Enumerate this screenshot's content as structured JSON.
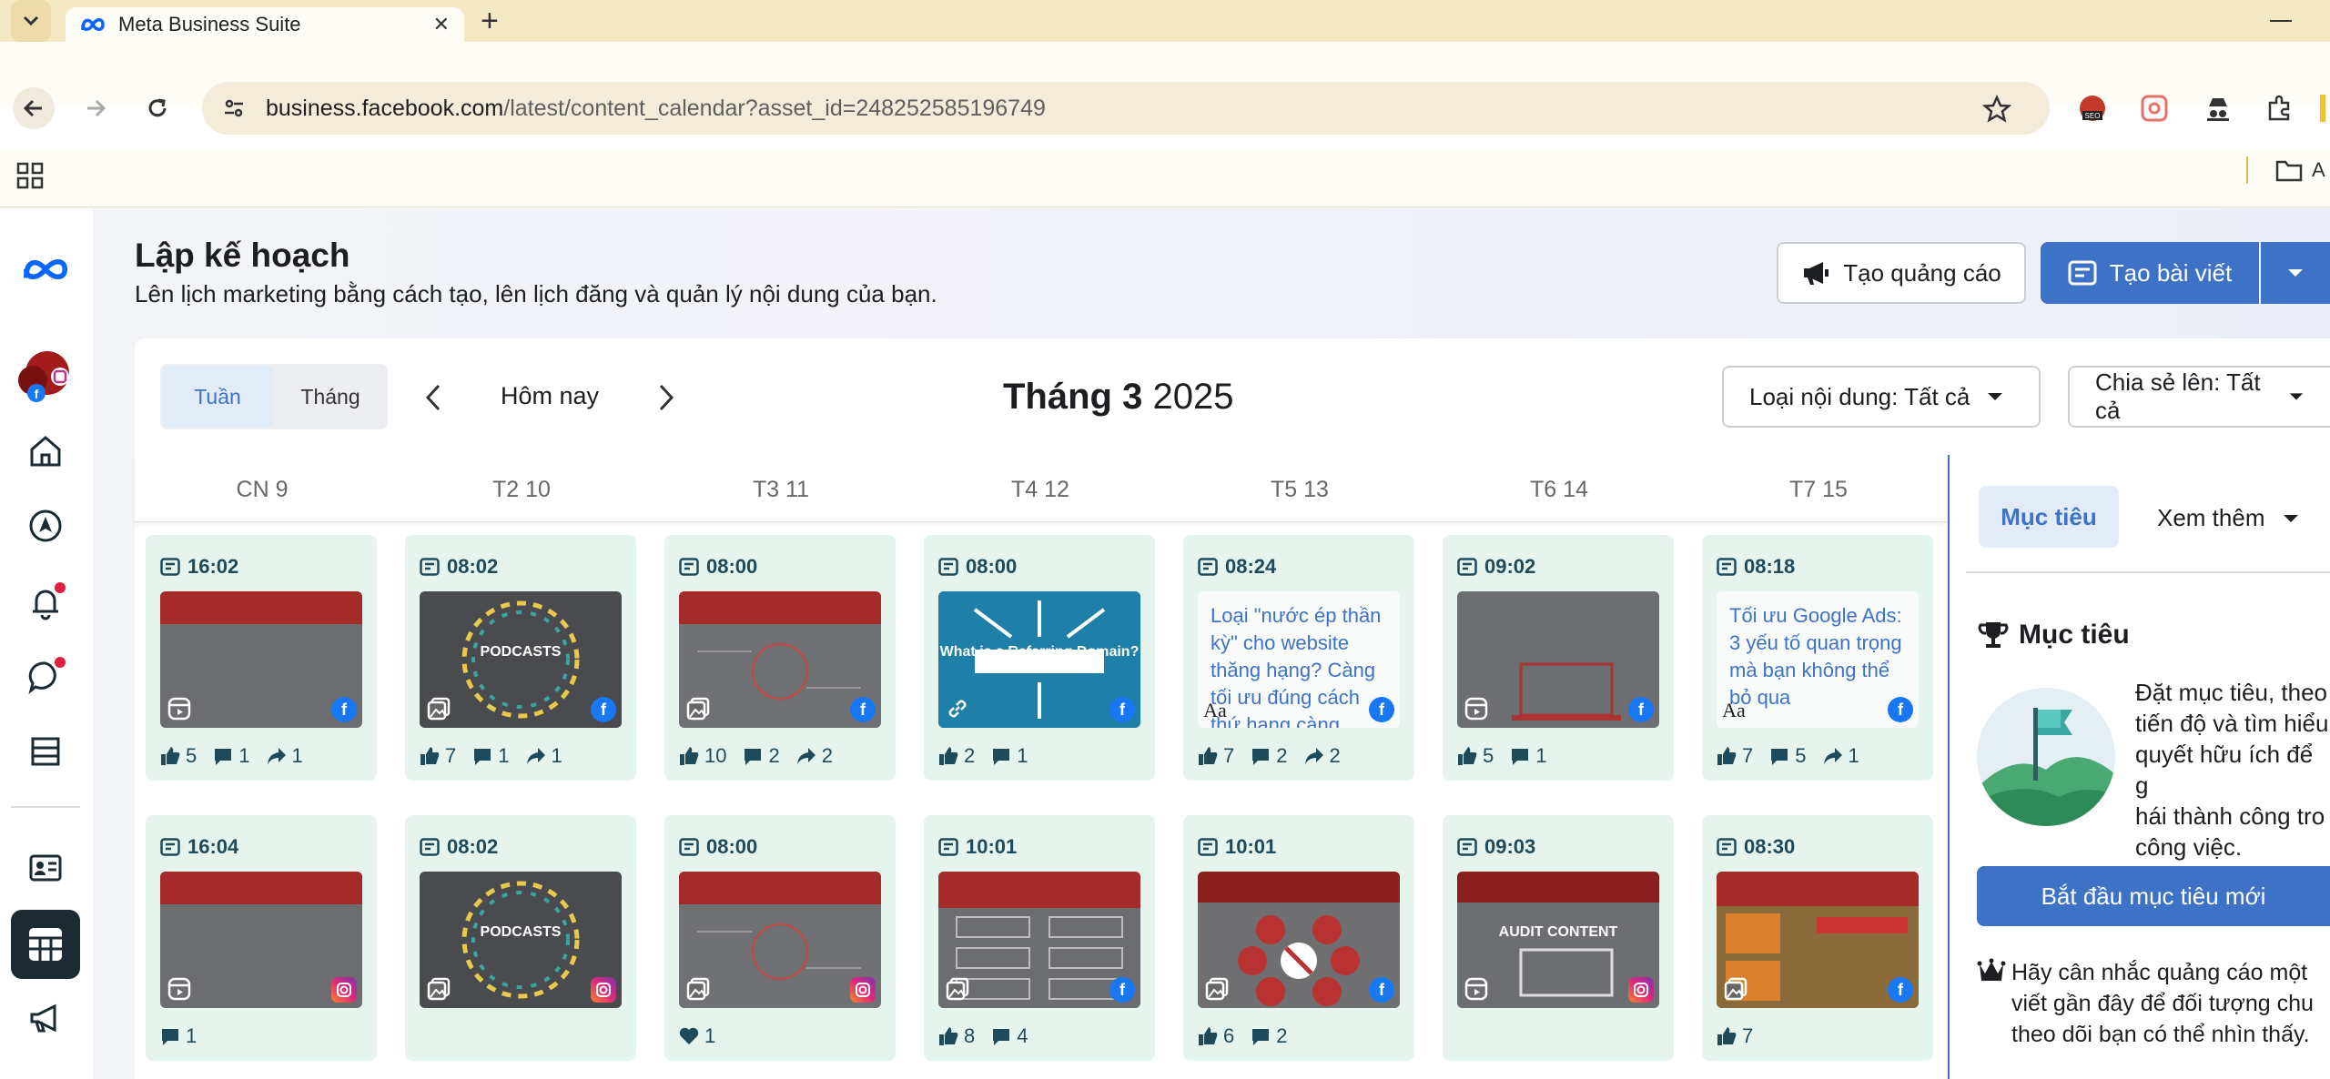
{
  "browser": {
    "tab_title": "Meta Business Suite",
    "url_host": "business.facebook.com",
    "url_path": "/latest/content_calendar?asset_id=248252585196749",
    "bookmark_folder": "A"
  },
  "header": {
    "title": "Lập kế hoạch",
    "subtitle": "Lên lịch marketing bằng cách tạo, lên lịch đăng và quản lý nội dung của bạn.",
    "create_ad": "Tạo quảng cáo",
    "create_post": "Tạo bài viết"
  },
  "calendar": {
    "view_week": "Tuần",
    "view_month": "Tháng",
    "today": "Hôm nay",
    "month": "Tháng 3",
    "year": "2025",
    "filter_content": "Loại nội dung: Tất cả",
    "filter_share": "Chia sẻ lên: Tất cả",
    "days": [
      "CN 9",
      "T2 10",
      "T3 11",
      "T4 12",
      "T5 13",
      "T6 14",
      "T7 15"
    ]
  },
  "posts_row1": [
    {
      "time": "16:02",
      "likes": "5",
      "comments": "1",
      "shares": "1"
    },
    {
      "time": "08:02",
      "likes": "7",
      "comments": "1",
      "shares": "1"
    },
    {
      "time": "08:00",
      "likes": "10",
      "comments": "2",
      "shares": "2"
    },
    {
      "time": "08:00",
      "likes": "2",
      "comments": "1"
    },
    {
      "time": "08:24",
      "text": "Loại \"nước ép thần kỳ\" cho website thăng hạng? Càng tối ưu đúng cách thứ hạng càng",
      "likes": "7",
      "comments": "2",
      "shares": "2"
    },
    {
      "time": "09:02",
      "likes": "5",
      "comments": "1"
    },
    {
      "time": "08:18",
      "text": "Tối ưu Google Ads: 3 yếu tố quan trọng mà bạn không thể bỏ qua",
      "likes": "7",
      "comments": "5",
      "shares": "1"
    }
  ],
  "posts_row2": [
    {
      "time": "16:04",
      "comments": "1"
    },
    {
      "time": "08:02"
    },
    {
      "time": "08:00",
      "hearts": "1"
    },
    {
      "time": "10:01",
      "likes": "8",
      "comments": "4"
    },
    {
      "time": "10:01",
      "likes": "6",
      "comments": "2"
    },
    {
      "time": "09:03"
    },
    {
      "time": "08:30",
      "likes": "7"
    }
  ],
  "right_panel": {
    "tab_goals": "Mục tiêu",
    "tab_more": "Xem thêm",
    "heading": "Mục tiêu",
    "description": "Đặt mục tiêu, theo\ntiến độ và tìm hiểu\nquyết hữu ích để g\nhái thành công tro\ncông việc.",
    "start_button": "Bắt đầu mục tiêu mới",
    "tip": "Hãy cân nhắc quảng cáo một\nviết gần đây để đối tượng chu\ntheo dõi bạn có thể nhìn thấy."
  },
  "thumb_captions": {
    "podcasts": "PODCASTS",
    "referring": "What is a Referring Domain?",
    "audit": "AUDIT CONTENT"
  },
  "colors": {
    "accent": "#3d72c7",
    "post_bg": "#e6f4ee",
    "facebook": "#1877f2"
  }
}
